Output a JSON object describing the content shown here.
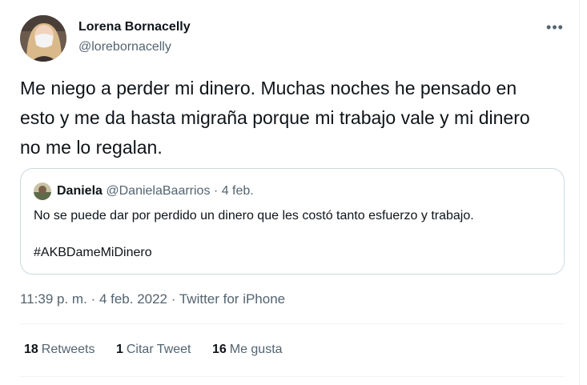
{
  "author": {
    "display_name": "Lorena Bornacelly",
    "handle": "@lorebornacelly"
  },
  "more_icon": "more-horizontal-icon",
  "tweet": {
    "text": "Me niego a perder mi dinero. Muchas noches he pensado en esto y me da hasta migraña porque mi trabajo vale y mi dinero no me lo regalan."
  },
  "quoted_tweet": {
    "display_name": "Daniela",
    "handle": "@DanielaBaarrios",
    "separator": "·",
    "date": "4 feb.",
    "text": "No se puede dar por perdido un dinero que les costó tanto esfuerzo y trabajo.",
    "hashtag": "#AKBDameMiDinero"
  },
  "meta": {
    "time": "11:39 p. m.",
    "sep1": "·",
    "date": "4 feb. 2022",
    "sep2": "·",
    "source": "Twitter for iPhone"
  },
  "stats": {
    "retweets_count": "18",
    "retweets_label": "Retweets",
    "quotes_count": "1",
    "quotes_label": "Citar Tweet",
    "likes_count": "16",
    "likes_label": "Me gusta"
  },
  "colors": {
    "text_primary": "#0f1419",
    "text_secondary": "#536471",
    "border": "#cfd9de",
    "divider": "#eff3f4"
  }
}
